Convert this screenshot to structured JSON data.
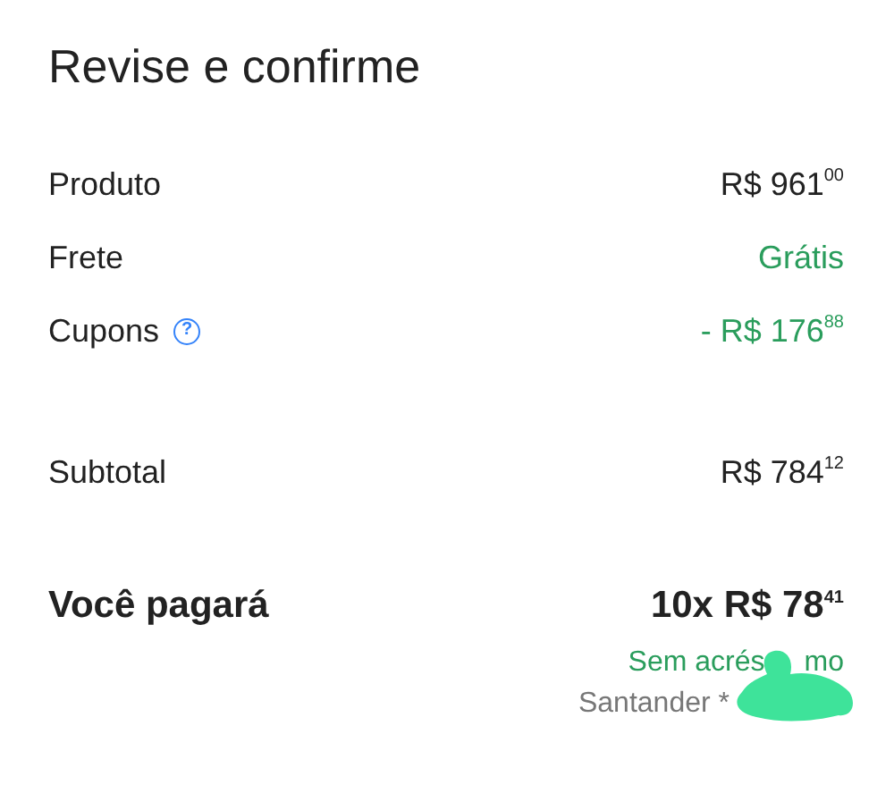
{
  "title": "Revise e confirme",
  "rows": [
    {
      "label": "Produto",
      "value": "R$ 961$^{00}$",
      "kind": "plain"
    },
    {
      "label": "Frete",
      "value": "Grátis",
      "kind": "discount"
    },
    {
      "label": "Cupons",
      "value": "- R$ 176$^{88}$",
      "kind": "discount",
      "info_icon": "?"
    }
  ],
  "subtotal": {
    "label": "Subtotal",
    "value": "R$ 784$^{12}$"
  },
  "total": {
    "label": "Você pagará",
    "value": "10x R$ 78$^{41}$",
    "note_start": "Sem acrés",
    "note_end": "mo",
    "card": "Santander *"
  }
}
